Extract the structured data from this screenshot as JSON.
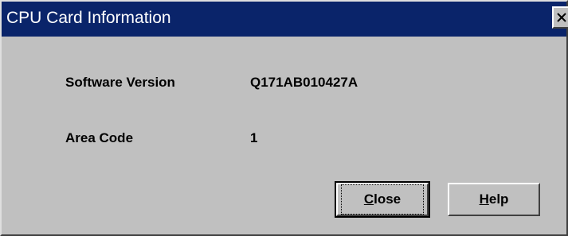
{
  "window": {
    "title": "CPU Card Information",
    "close_icon": "close-icon"
  },
  "info": {
    "software_version_label": "Software Version",
    "software_version_value": "Q171AB010427A",
    "area_code_label": "Area Code",
    "area_code_value": "1"
  },
  "buttons": {
    "close": {
      "mnemonic": "C",
      "rest": "lose"
    },
    "help": {
      "mnemonic": "H",
      "rest": "elp"
    }
  },
  "colors": {
    "titlebar": "#0a246a",
    "face": "#c0c0c0"
  }
}
